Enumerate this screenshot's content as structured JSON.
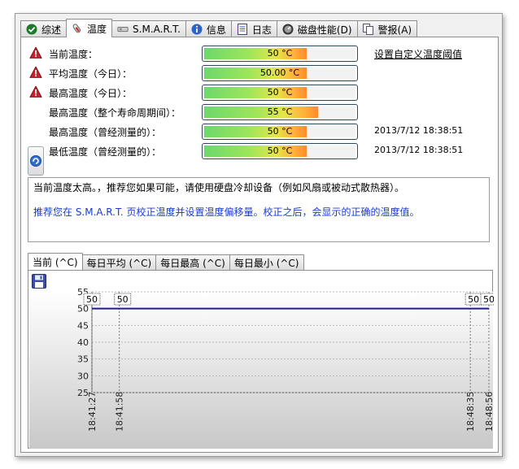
{
  "tabs": [
    {
      "label": "综述",
      "icon": "check-circle-icon",
      "active": false
    },
    {
      "label": "温度",
      "icon": "thermometer-icon",
      "active": true
    },
    {
      "label": "S.M.A.R.T.",
      "icon": "disk-icon",
      "active": false
    },
    {
      "label": "信息",
      "icon": "info-icon",
      "active": false
    },
    {
      "label": "日志",
      "icon": "document-icon",
      "active": false
    },
    {
      "label": "磁盘性能(D)",
      "icon": "gauge-icon",
      "active": false
    },
    {
      "label": "警报(A)",
      "icon": "alert-copy-icon",
      "active": false
    }
  ],
  "rows": {
    "current": {
      "label": "当前温度：",
      "value": "50 °C",
      "fill": 0.68,
      "warn": true
    },
    "avg_today": {
      "label": "平均温度（今日）：",
      "value": "50.00 °C",
      "fill": 0.68,
      "warn": true
    },
    "max_today": {
      "label": "最高温度（今日）：",
      "value": "50 °C",
      "fill": 0.68,
      "warn": true
    },
    "max_life": {
      "label": "最高温度（整个寿命周期间）：",
      "value": "55 °C",
      "fill": 0.75,
      "warn": false
    },
    "max_measured": {
      "label": "最高温度（曾经测量的）：",
      "value": "50 °C",
      "fill": 0.68,
      "warn": false,
      "date": "2013/7/12 18:38:51"
    },
    "min_measured": {
      "label": "最低温度（曾经测量的）：",
      "value": "50 °C",
      "fill": 0.68,
      "warn": false,
      "date": "2013/7/12 18:38:51"
    }
  },
  "threshold_link": "设置自定义温度阈值",
  "messages": {
    "line1": "当前温度太高。，推荐您如果可能，请使用硬盘冷却设备（例如风扇或被动式散热器）。",
    "line2": "推荐您在 S.M.A.R.T. 页校正温度并设置温度偏移量。校正之后，会显示的正确的温度值。"
  },
  "chart_tabs": [
    {
      "label": "当前 (^C)",
      "active": true
    },
    {
      "label": "每日平均 (^C)",
      "active": false
    },
    {
      "label": "每日最高 (^C)",
      "active": false
    },
    {
      "label": "每日最小 (^C)",
      "active": false
    }
  ],
  "chart_data": {
    "type": "line",
    "yticks": [
      55,
      50,
      45,
      40,
      35,
      30,
      25
    ],
    "ylim": [
      25,
      55
    ],
    "x": [
      "18:41:27",
      "18:41:58",
      "18:48:35",
      "18:48:56"
    ],
    "series": [
      {
        "values": [
          50,
          50,
          50,
          50
        ]
      }
    ],
    "data_labels": [
      "50",
      "50",
      "50",
      "50"
    ],
    "line_color": "#1a1aa0"
  }
}
